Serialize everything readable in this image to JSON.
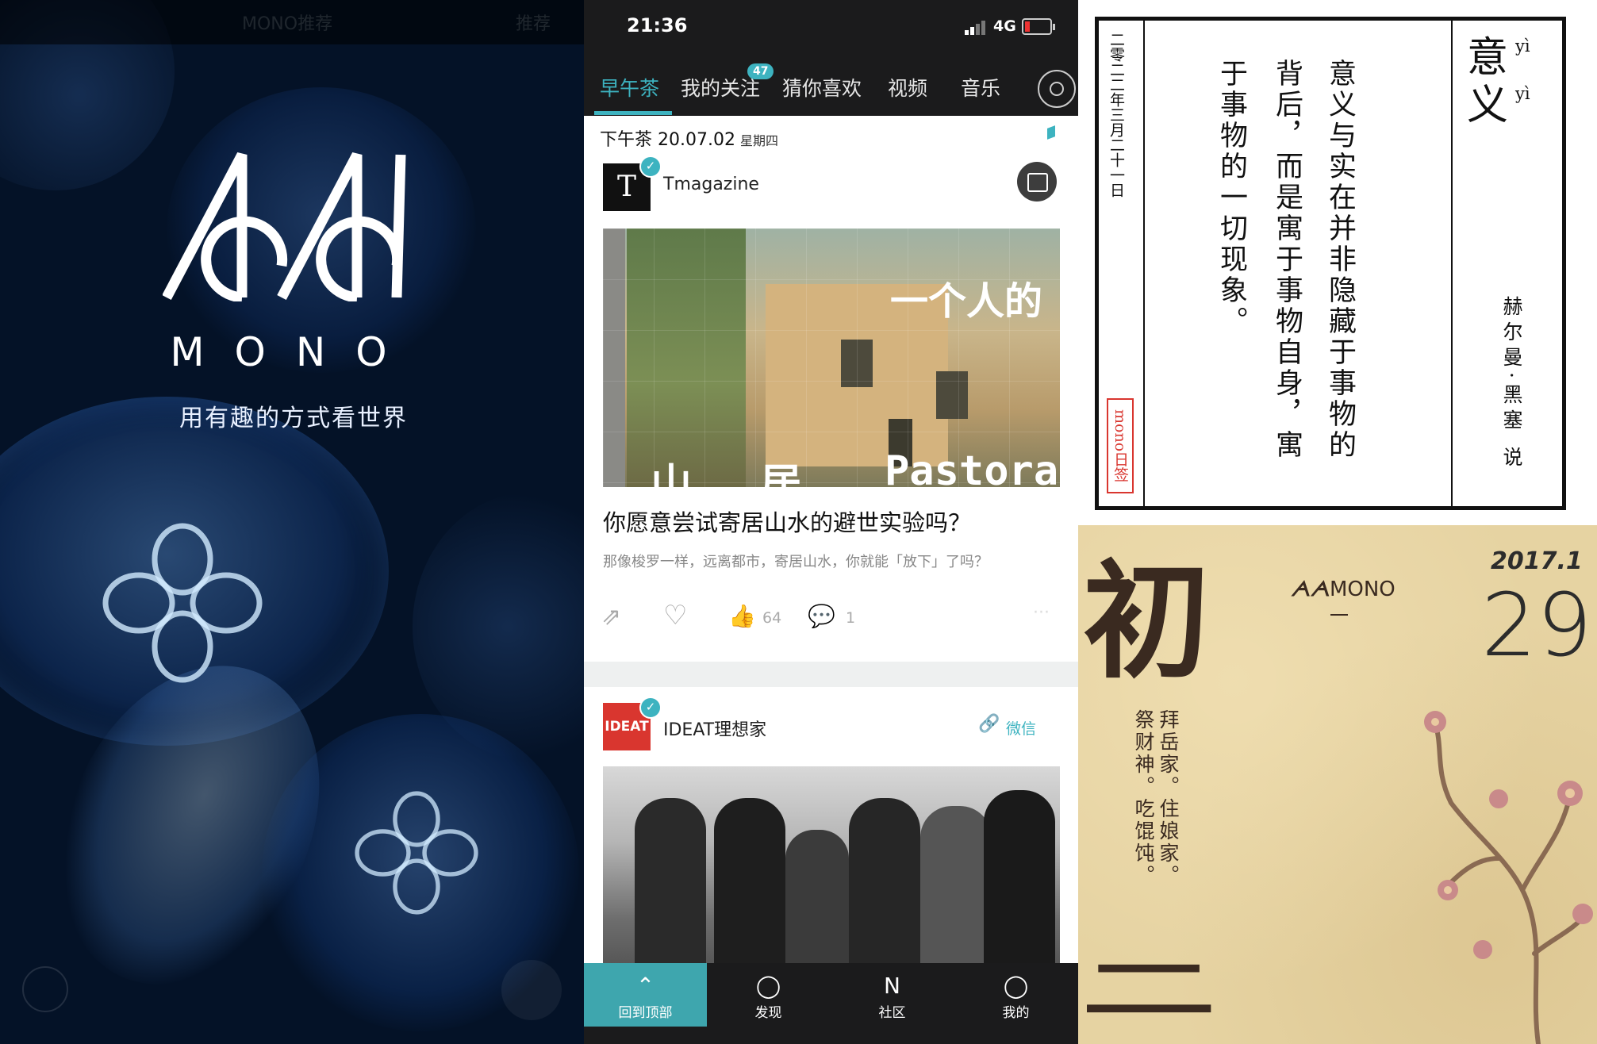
{
  "splash": {
    "topbar_left": "MONO推荐",
    "topbar_right": "推荐",
    "brand": "MONO",
    "slogan": "用有趣的方式看世界"
  },
  "feed": {
    "status": {
      "time": "21:36",
      "network": "4G"
    },
    "tabs": [
      {
        "label": "早午茶",
        "active": true
      },
      {
        "label": "我的关注",
        "badge": "47"
      },
      {
        "label": "猜你喜欢"
      },
      {
        "label": "视频"
      },
      {
        "label": "音乐"
      }
    ],
    "date_label": "下午茶 20.07.02",
    "weekday": "星期四",
    "card1": {
      "author": "Tmagazine",
      "avatar_letter": "T",
      "cover_text_a": "一个人的",
      "cover_text_b": "山",
      "cover_text_c": "居",
      "cover_text_d": "Pastoral",
      "title": "你愿意尝试寄居山水的避世实验吗？",
      "subtitle": "那像梭罗一样，远离都市，寄居山水，你就能「放下」了吗？",
      "likes": "64",
      "comments": "1"
    },
    "card2": {
      "author": "IDEAT理想家",
      "avatar_text": "IDEAT",
      "source": "微信"
    },
    "bottom_nav": [
      {
        "label": "回到顶部",
        "icon": "^",
        "active": true
      },
      {
        "label": "发现",
        "icon": "O"
      },
      {
        "label": "社区",
        "icon": "N"
      },
      {
        "label": "我的",
        "icon": "O"
      }
    ],
    "accent_color": "#3db3c0"
  },
  "quote_card": {
    "word": "意义",
    "word_char1": "意",
    "word_char2": "义",
    "pinyin1": "yì",
    "pinyin2": "yì",
    "date": "二零二二年三月二十一日",
    "seal": "mono日签",
    "quote_col1": "意义与实在并非隐藏于事物的",
    "quote_col2": "背后，而是寓于事物自身，寓",
    "quote_col3": "于事物的一切现象。",
    "attribution": "赫尔曼·黑塞 说"
  },
  "calendar": {
    "big_char_top": "初",
    "big_char_bottom": "二",
    "logo": "MONO",
    "month": "2017.1",
    "day": "29",
    "text_col1": "拜岳家。住娘家。",
    "text_col2": "祭财神。吃馄饨。"
  }
}
